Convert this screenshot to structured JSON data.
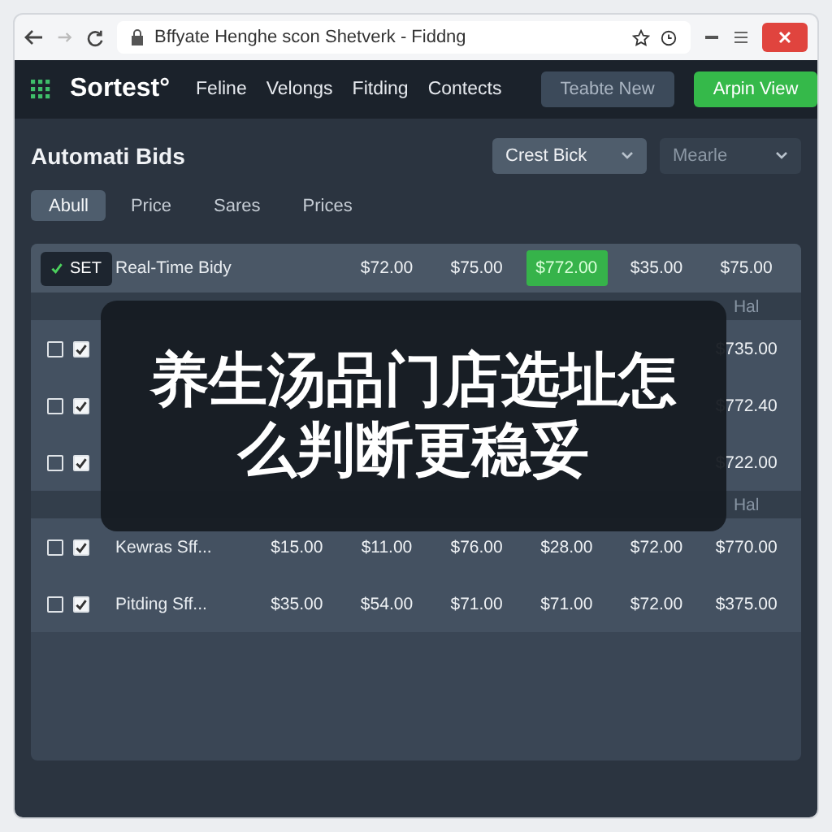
{
  "browser": {
    "url": "Bffyate Henghe scon Shetverk - Fiddng"
  },
  "nav": {
    "logo": "Sortest°",
    "links": [
      "Feline",
      "Velongs",
      "Fitding",
      "Contects"
    ],
    "buttons": [
      {
        "label": "Teabte New",
        "kind": "secondary"
      },
      {
        "label": "Arpin View",
        "kind": "primary"
      }
    ]
  },
  "header": {
    "title": "Automati Bids",
    "dropdowns": [
      {
        "label": "Crest Bick",
        "selected": true
      },
      {
        "label": "Mearle",
        "selected": false
      }
    ]
  },
  "tabs": [
    {
      "label": "Abull",
      "selected": true
    },
    {
      "label": "Price",
      "selected": false
    },
    {
      "label": "Sares",
      "selected": false
    },
    {
      "label": "Prices",
      "selected": false
    }
  ],
  "table": {
    "rows": [
      {
        "kind": "header",
        "badge": "SET",
        "name": "Real-Time Bidy",
        "cells": [
          null,
          {
            "value": "$72.00",
            "highlighted": false
          },
          {
            "value": "$75.00",
            "highlighted": false
          },
          {
            "value": "$772.00",
            "highlighted": true
          },
          {
            "value": "$35.00",
            "highlighted": false
          },
          {
            "value": "$75.00",
            "highlighted": false
          }
        ]
      },
      {
        "kind": "subheader",
        "cells": [
          null,
          null,
          null,
          null,
          null,
          "Hal"
        ]
      },
      {
        "kind": "row",
        "checks": [
          false,
          true
        ],
        "name": null,
        "cells": [
          null,
          null,
          null,
          null,
          null,
          "$735.00"
        ]
      },
      {
        "kind": "row",
        "checks": [
          false,
          true
        ],
        "name": null,
        "cells": [
          null,
          null,
          null,
          null,
          null,
          "$772.40"
        ]
      },
      {
        "kind": "row",
        "checks": [
          false,
          true
        ],
        "name": null,
        "cells": [
          null,
          null,
          null,
          null,
          null,
          "$722.00"
        ]
      },
      {
        "kind": "subheader",
        "cells": [
          null,
          null,
          null,
          null,
          null,
          "Hal"
        ]
      },
      {
        "kind": "row",
        "checks": [
          false,
          true
        ],
        "name": "Kewras Sff...",
        "cells": [
          "$15.00",
          "$11.00",
          "$76.00",
          "$28.00",
          "$72.00",
          "$770.00"
        ]
      },
      {
        "kind": "row",
        "checks": [
          false,
          true
        ],
        "name": "Pitding Sff...",
        "cells": [
          "$35.00",
          "$54.00",
          "$71.00",
          "$71.00",
          "$72.00",
          "$375.00"
        ]
      }
    ]
  },
  "overlay": {
    "lines": [
      "养生汤品门店选址怎",
      "么判断更稳妥"
    ]
  }
}
